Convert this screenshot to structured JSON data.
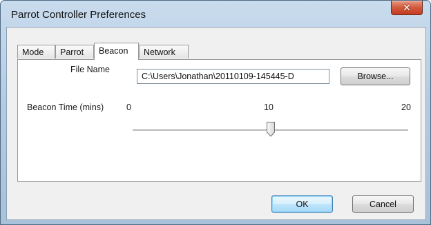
{
  "window": {
    "title": "Parrot Controller Preferences",
    "close_icon": "close-icon"
  },
  "tabs": [
    {
      "label": "Mode",
      "active": false
    },
    {
      "label": "Parrot",
      "active": false
    },
    {
      "label": "Beacon",
      "active": true
    },
    {
      "label": "Network",
      "active": false
    }
  ],
  "beacon": {
    "file_name_label": "File Name",
    "file_name_value": "C:\\Users\\Jonathan\\20110109-145445-D",
    "browse_label": "Browse...",
    "beacon_time_label": "Beacon Time (mins)",
    "ticks": [
      "0",
      "10",
      "20"
    ],
    "slider": {
      "min": 0,
      "max": 20,
      "value": 10
    }
  },
  "buttons": {
    "ok_label": "OK",
    "cancel_label": "Cancel"
  },
  "colors": {
    "accent": "#3c7fb1",
    "close": "#c43b1f"
  }
}
